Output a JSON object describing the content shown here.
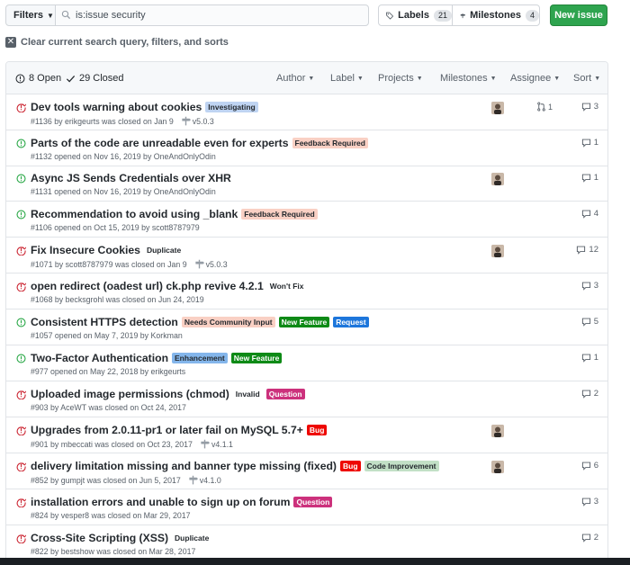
{
  "toolbar": {
    "filters_label": "Filters",
    "search_value": "is:issue security",
    "labels_label": "Labels",
    "labels_count": "21",
    "milestones_label": "Milestones",
    "milestones_count": "4",
    "new_issue_label": "New issue"
  },
  "clear_text": "Clear current search query, filters, and sorts",
  "header": {
    "open_label": "8 Open",
    "closed_label": "29 Closed",
    "filters": [
      "Author",
      "Label",
      "Projects",
      "Milestones",
      "Assignee",
      "Sort"
    ]
  },
  "colors": {
    "open": "#28a745",
    "closed": "#cb2431",
    "green_button": "#2ea44f"
  },
  "issues": [
    {
      "state": "closed",
      "title": "Dev tools warning about cookies",
      "labels": [
        {
          "text": "Investigating",
          "bg": "#bfd4f2",
          "fg": "#24292e"
        }
      ],
      "meta": "#1136 by erikgeurts was closed on Jan 9",
      "milestone": "v5.0.3",
      "avatar": true,
      "pr": "1",
      "comments": "3"
    },
    {
      "state": "open",
      "title": "Parts of the code are unreadable even for experts",
      "labels": [
        {
          "text": "Feedback Required",
          "bg": "#f9d0c4",
          "fg": "#24292e"
        }
      ],
      "meta": "#1132 opened on Nov 16, 2019 by OneAndOnlyOdin",
      "milestone": "",
      "avatar": false,
      "pr": "",
      "comments": "1"
    },
    {
      "state": "open",
      "title": "Async JS Sends Credentials over XHR",
      "labels": [],
      "meta": "#1131 opened on Nov 16, 2019 by OneAndOnlyOdin",
      "milestone": "",
      "avatar": true,
      "pr": "",
      "comments": "1"
    },
    {
      "state": "open",
      "title": "Recommendation to avoid using _blank",
      "labels": [
        {
          "text": "Feedback Required",
          "bg": "#f9d0c4",
          "fg": "#24292e"
        }
      ],
      "meta": "#1106 opened on Oct 15, 2019 by scott8787979",
      "milestone": "",
      "avatar": false,
      "pr": "",
      "comments": "4"
    },
    {
      "state": "closed",
      "title": "Fix Insecure Cookies",
      "labels": [
        {
          "text": "Duplicate",
          "bg": "#ffffff",
          "fg": "#24292e"
        }
      ],
      "meta": "#1071 by scott8787979 was closed on Jan 9",
      "milestone": "v5.0.3",
      "avatar": true,
      "pr": "",
      "comments": "12"
    },
    {
      "state": "closed",
      "title": "open redirect (oadest url) ck.php revive 4.2.1",
      "labels": [
        {
          "text": "Won't Fix",
          "bg": "#ffffff",
          "fg": "#24292e"
        }
      ],
      "meta": "#1068 by becksgrohl was closed on Jun 24, 2019",
      "milestone": "",
      "avatar": false,
      "pr": "",
      "comments": "3"
    },
    {
      "state": "open",
      "title": "Consistent HTTPS detection",
      "labels": [
        {
          "text": "Needs Community Input",
          "bg": "#f9d0c4",
          "fg": "#24292e"
        },
        {
          "text": "New Feature",
          "bg": "#0e8a16",
          "fg": "#ffffff"
        },
        {
          "text": "Request",
          "bg": "#1d76db",
          "fg": "#ffffff"
        }
      ],
      "meta": "#1057 opened on May 7, 2019 by Korkman",
      "milestone": "",
      "avatar": false,
      "pr": "",
      "comments": "5"
    },
    {
      "state": "open",
      "title": "Two-Factor Authentication",
      "labels": [
        {
          "text": "Enhancement",
          "bg": "#84b6eb",
          "fg": "#24292e"
        },
        {
          "text": "New Feature",
          "bg": "#0e8a16",
          "fg": "#ffffff"
        }
      ],
      "meta": "#977 opened on May 22, 2018 by erikgeurts",
      "milestone": "",
      "avatar": false,
      "pr": "",
      "comments": "1"
    },
    {
      "state": "closed",
      "title": "Uploaded image permissions (chmod)",
      "labels": [
        {
          "text": "Invalid",
          "bg": "#ffffff",
          "fg": "#24292e"
        },
        {
          "text": "Question",
          "bg": "#cc317c",
          "fg": "#ffffff"
        }
      ],
      "meta": "#903 by AceWT was closed on Oct 24, 2017",
      "milestone": "",
      "avatar": false,
      "pr": "",
      "comments": "2"
    },
    {
      "state": "closed",
      "title": "Upgrades from 2.0.11-pr1 or later fail on MySQL 5.7+",
      "labels": [
        {
          "text": "Bug",
          "bg": "#ee0701",
          "fg": "#ffffff"
        }
      ],
      "meta": "#901 by mbeccati was closed on Oct 23, 2017",
      "milestone": "v4.1.1",
      "avatar": true,
      "pr": "",
      "comments": ""
    },
    {
      "state": "closed",
      "title": "delivery limitation missing and banner type missing (fixed)",
      "labels": [
        {
          "text": "Bug",
          "bg": "#ee0701",
          "fg": "#ffffff"
        },
        {
          "text": "Code Improvement",
          "bg": "#c2e0c6",
          "fg": "#24292e"
        }
      ],
      "meta": "#852 by gumpjt was closed on Jun 5, 2017",
      "milestone": "v4.1.0",
      "avatar": true,
      "pr": "",
      "comments": "6"
    },
    {
      "state": "closed",
      "title": "installation errors and unable to sign up on forum",
      "labels": [
        {
          "text": "Question",
          "bg": "#cc317c",
          "fg": "#ffffff"
        }
      ],
      "meta": "#824 by vesper8 was closed on Mar 29, 2017",
      "milestone": "",
      "avatar": false,
      "pr": "",
      "comments": "3"
    },
    {
      "state": "closed",
      "title": "Cross-Site Scripting (XSS)",
      "labels": [
        {
          "text": "Duplicate",
          "bg": "#ffffff",
          "fg": "#24292e"
        }
      ],
      "meta": "#822 by bestshow was closed on Mar 28, 2017",
      "milestone": "",
      "avatar": false,
      "pr": "",
      "comments": "2"
    }
  ]
}
